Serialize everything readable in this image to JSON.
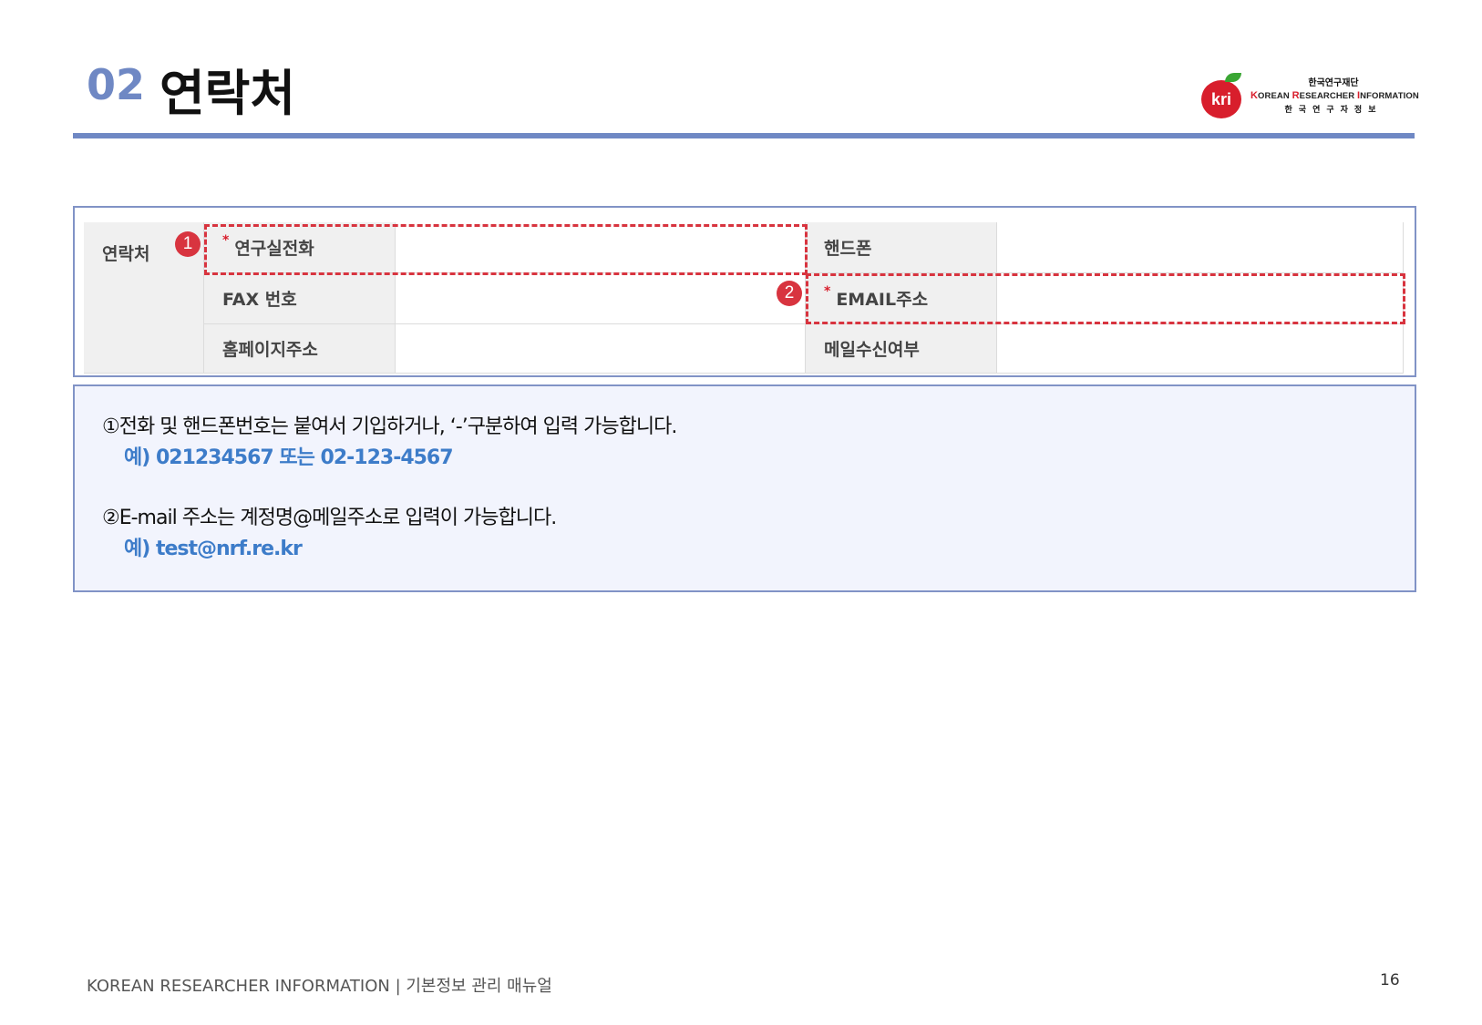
{
  "header": {
    "number": "02",
    "title": "연락처"
  },
  "logo": {
    "korean": "한국연구재단",
    "english_parts": [
      "K",
      "OREAN ",
      "R",
      "ESEARCHER ",
      "I",
      "NFORMATION"
    ],
    "spaced": "한국연구자정보",
    "badge": "kri"
  },
  "form": {
    "group_label": "연락처",
    "required_mark": "*",
    "rows": [
      {
        "left_label": "연구실전화",
        "left_required": true,
        "right_label": "핸드폰",
        "right_required": false
      },
      {
        "left_label": "FAX 번호",
        "left_required": false,
        "right_label": "EMAIL주소",
        "right_required": true
      },
      {
        "left_label": "홈페이지주소",
        "left_required": false,
        "right_label": "메일수신여부",
        "right_required": false
      }
    ],
    "markers": [
      "1",
      "2"
    ]
  },
  "notes": [
    {
      "text": "①전화 및 핸드폰번호는 붙여서 기입하거나, ‘-’구분하여 입력 가능합니다.",
      "example": "예) 021234567 또는 02-123-4567"
    },
    {
      "text": "②E-mail 주소는 계정명@메일주소로 입력이 가능합니다.",
      "example": "예) test@nrf.re.kr"
    }
  ],
  "footer": {
    "text": "KOREAN RESEARCHER INFORMATION   |  기본정보 관리 매뉴얼",
    "page": "16"
  },
  "colors": {
    "accent": "#6f88c4",
    "marker_red": "#d8343f",
    "example_blue": "#3d7cc9",
    "notes_bg": "#f2f4fd"
  }
}
